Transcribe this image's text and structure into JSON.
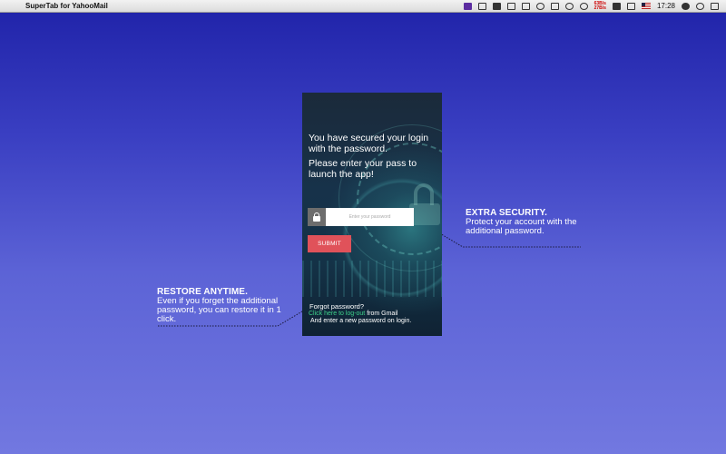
{
  "menubar": {
    "app_name": "SuperTab for YahooMail",
    "net_up": "63B/s",
    "net_down": "27B/s",
    "clock": "17:28",
    "icons": [
      "apple-icon",
      "yahoo-mail-icon",
      "dropbox-icon",
      "text-icon",
      "box-icon",
      "display-icon",
      "cloud-icon",
      "airplay-icon",
      "time-machine-icon",
      "wifi-icon",
      "network-speed-icon",
      "volume-icon",
      "battery-icon",
      "flag-icon",
      "clock-icon",
      "user-icon",
      "spotlight-icon",
      "menu-icon"
    ]
  },
  "panel": {
    "message1": "You have secured your login with the password.",
    "message2": "Please enter your pass to launch the app!",
    "password_placeholder": "Enter your password",
    "submit_label": "SUBMIT",
    "forgot_label": "Forgot password?",
    "logout_link": "Click here to log-out",
    "logout_suffix": " from Gmail",
    "new_password_note": "And enter a new password on login."
  },
  "callouts": {
    "right_title": "EXTRA SECURITY.",
    "right_body": "Protect your account with the additional password.",
    "left_title": "RESTORE ANYTIME.",
    "left_body": "Even if you forget the additional password, you can restore it in 1 click."
  },
  "colors": {
    "background_top": "#1f22a8",
    "background_bottom": "#7278e0",
    "submit": "#e0525a",
    "link": "#3fd08a"
  }
}
